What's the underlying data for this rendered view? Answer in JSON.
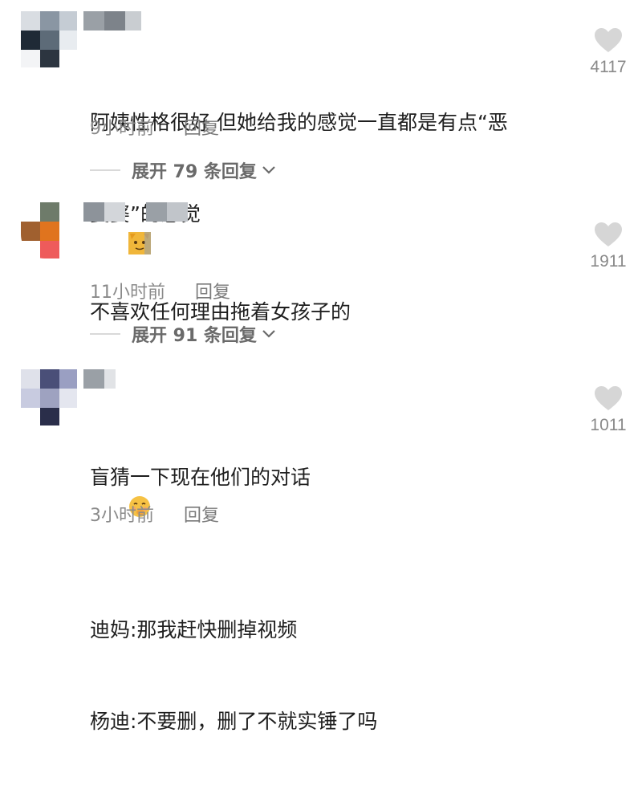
{
  "comments": [
    {
      "username": "",
      "lines": [
        "阿姨性格很好 但她给我的感觉一直都是有点“恶",
        "婆婆”的感觉"
      ],
      "emoji": "cat-face-icon",
      "time": "9小时前",
      "reply_label": "回复",
      "expand_label": "展开 79 条回复",
      "likes": "4117"
    },
    {
      "username": "",
      "lines": [
        "不喜欢任何理由拖着女孩子的"
      ],
      "time": "11小时前",
      "reply_label": "回复",
      "expand_label": "展开 91 条回复",
      "likes": "1911"
    },
    {
      "username": "",
      "lines": [
        "盲猜一下现在他们的对话",
        "迪妈:那我赶快删掉视频",
        "杨迪:不要删，删了不就实锤了吗"
      ],
      "emoji": "shy-face-icon",
      "time": "3小时前",
      "reply_label": "回复",
      "likes": "1011"
    }
  ],
  "colors": {
    "text": "#1f1f1f",
    "meta": "#8a8a8a",
    "heart": "#d6d6d6"
  }
}
